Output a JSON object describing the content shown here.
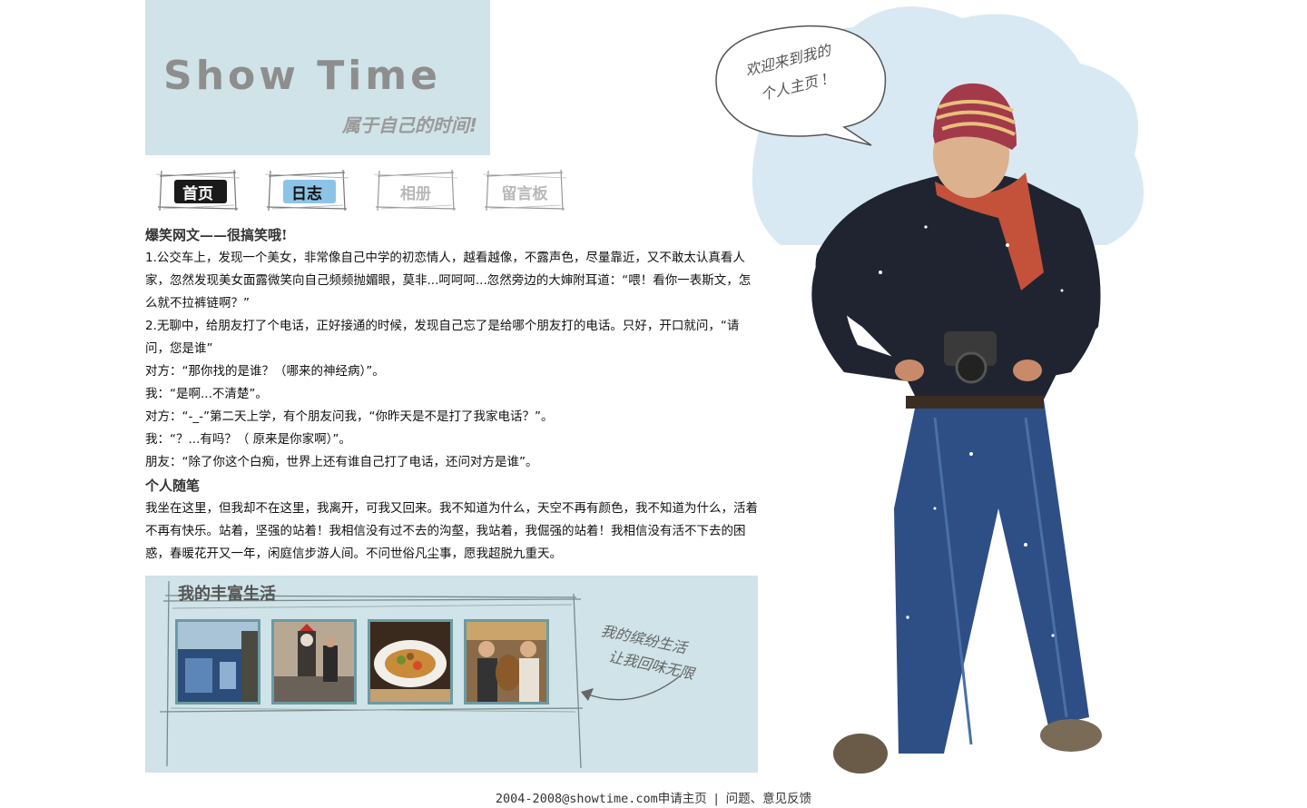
{
  "header": {
    "title": "Show Time",
    "subtitle": "属于自己的时间!"
  },
  "nav": {
    "items": [
      {
        "label": "首页",
        "state": "active-black"
      },
      {
        "label": "日志",
        "state": "active-blue"
      },
      {
        "label": "相册",
        "state": "normal"
      },
      {
        "label": "留言板",
        "state": "normal"
      }
    ]
  },
  "article": {
    "heading1": "爆笑网文——很搞笑哦!",
    "lines": [
      "1.公交车上，发现一个美女，非常像自己中学的初恋情人，越看越像，不露声色，尽量靠近，又不敢太认真看人家，忽然发现美女面露微笑向自己频频抛媚眼，莫非...呵呵呵...忽然旁边的大婶附耳道：“喂！看你一表斯文，怎么就不拉裤链啊？”",
      "2.无聊中，给朋友打了个电话，正好接通的时候，发现自己忘了是给哪个朋友打的电话。只好，开口就问，“请问，您是谁”",
      "对方：“那你找的是谁？（哪来的神经病）”。",
      "我：“是啊...不清楚”。",
      "对方：“-_-”第二天上学，有个朋友问我，“你昨天是不是打了我家电话？”。",
      "我：“？...有吗？（ 原来是你家啊）”。",
      "朋友：“除了你这个白痴，世界上还有谁自己打了电话，还问对方是谁”。"
    ],
    "heading2": "个人随笔",
    "essay": "我坐在这里，但我却不在这里，我离开，可我又回来。我不知道为什么，天空不再有颜色，我不知道为什么，活着不再有快乐。站着，坚强的站着！我相信没有过不去的沟壑，我站着，我倔强的站着！我相信没有活不下去的困惑，春暖花开又一年，闲庭信步游人间。不问世俗凡尘事，愿我超脱九重天。"
  },
  "gallery": {
    "title": "我的丰富生活",
    "note_line1": "我的缤纷生活",
    "note_line2": "让我回味无限",
    "photos": [
      {
        "icon": "street-poster-photo"
      },
      {
        "icon": "statue-photo"
      },
      {
        "icon": "food-plate-photo"
      },
      {
        "icon": "friends-mascot-photo"
      }
    ]
  },
  "speech": {
    "line1": "欢迎来到我的",
    "line2": "个人主页 !"
  },
  "footer": {
    "copyright": "2004-2008@showtime.com",
    "link1": "申请主页",
    "separator": "|",
    "link2": "问题、意见反馈"
  },
  "colors": {
    "panel": "#cfe3e8",
    "accent_blue": "#8cc4e8",
    "thumb_border": "#6c9aa3"
  }
}
